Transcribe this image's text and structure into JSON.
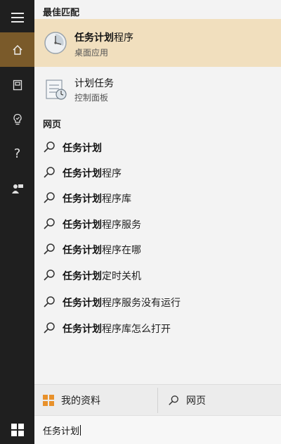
{
  "sidebar": {
    "items": [
      {
        "icon": "hamburger-menu-icon"
      },
      {
        "icon": "home-icon",
        "active": true
      },
      {
        "icon": "notebook-icon"
      },
      {
        "icon": "lightbulb-icon"
      },
      {
        "icon": "question-icon"
      },
      {
        "icon": "feedback-icon"
      }
    ],
    "active_color": "#7a5a2a"
  },
  "best_match": {
    "section_label": "最佳匹配",
    "title_bold": "任务计划",
    "title_rest": "程序",
    "subtitle": "桌面应用",
    "highlight_color": "#f1dfbe"
  },
  "second_result": {
    "title": "计划任务",
    "subtitle": "控制面板"
  },
  "web": {
    "section_label": "网页",
    "suggestions": [
      {
        "bold": "任务计划",
        "rest": ""
      },
      {
        "bold": "任务计划",
        "rest": "程序"
      },
      {
        "bold": "任务计划",
        "rest": "程序库"
      },
      {
        "bold": "任务计划",
        "rest": "程序服务"
      },
      {
        "bold": "任务计划",
        "rest": "程序在哪"
      },
      {
        "bold": "任务计划",
        "rest": "定时关机"
      },
      {
        "bold": "任务计划",
        "rest": "程序服务没有运行"
      },
      {
        "bold": "任务计划",
        "rest": "程序库怎么打开"
      }
    ]
  },
  "bottom_tabs": {
    "my_stuff": "我的资料",
    "web": "网页"
  },
  "search": {
    "value": "任务计划"
  }
}
